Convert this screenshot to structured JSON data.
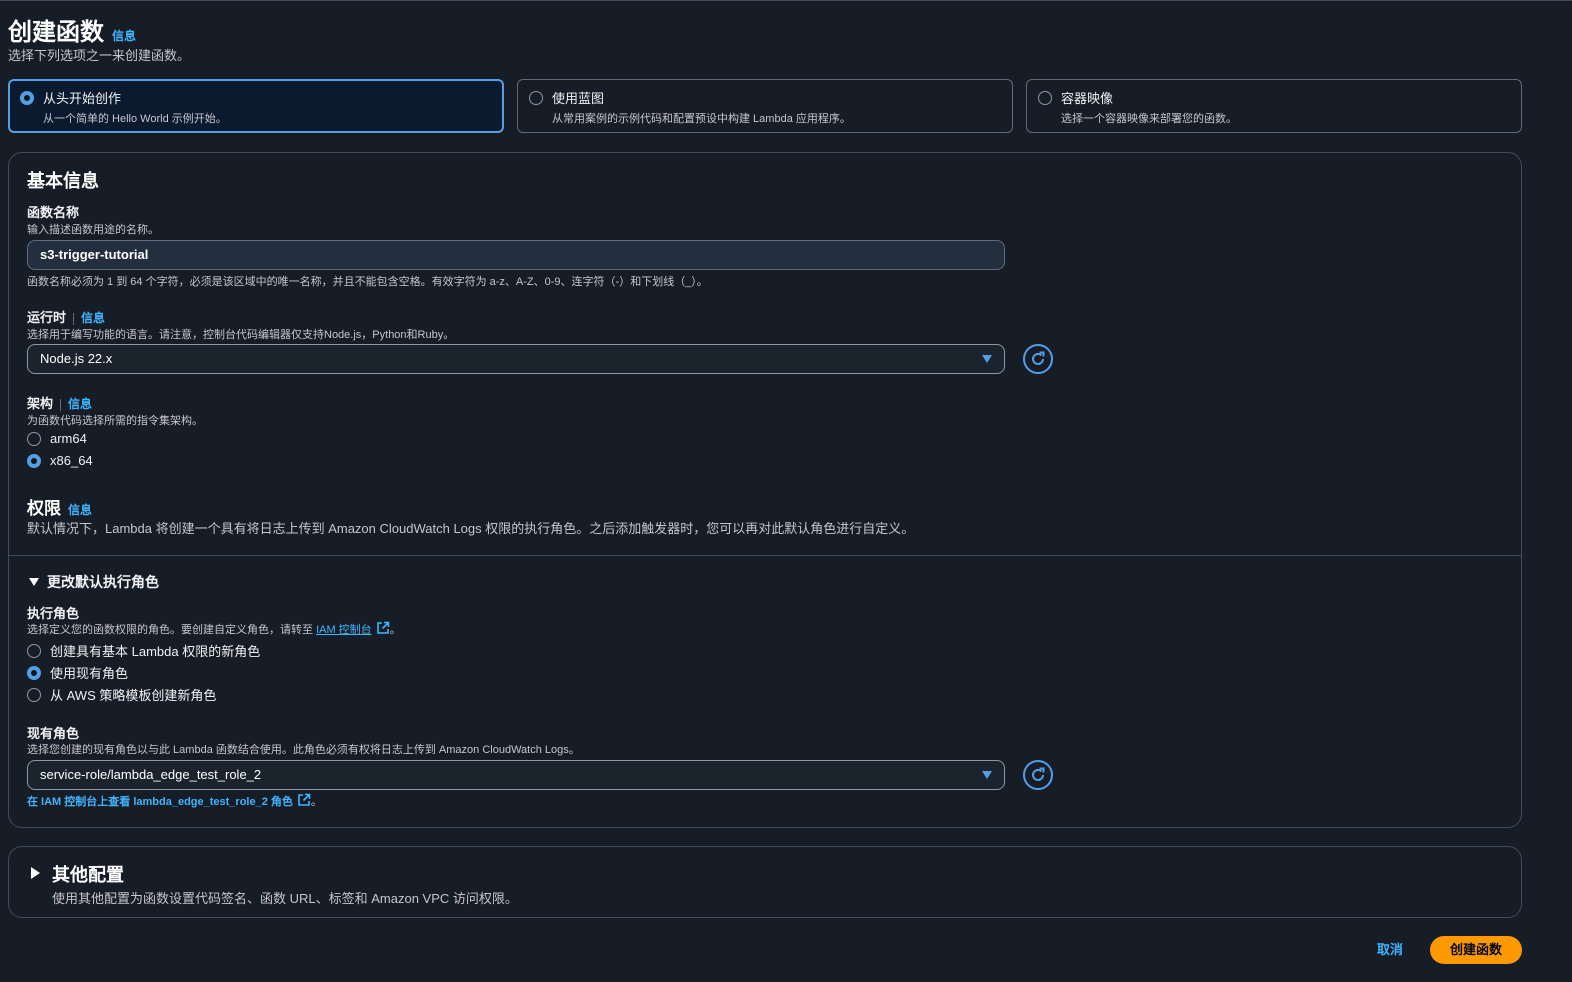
{
  "header": {
    "title": "创建函数",
    "info": "信息",
    "description": "选择下列选项之一来创建函数。"
  },
  "options": [
    {
      "title": "从头开始创作",
      "desc": "从一个简单的 Hello World 示例开始。",
      "selected": true
    },
    {
      "title": "使用蓝图",
      "desc": "从常用案例的示例代码和配置预设中构建 Lambda 应用程序。",
      "selected": false
    },
    {
      "title": "容器映像",
      "desc": "选择一个容器映像来部署您的函数。",
      "selected": false
    }
  ],
  "basic": {
    "title": "基本信息",
    "function_name": {
      "label": "函数名称",
      "desc": "输入描述函数用途的名称。",
      "value": "s3-trigger-tutorial",
      "constraint": "函数名称必须为 1 到 64 个字符，必须是该区域中的唯一名称，并且不能包含空格。有效字符为 a-z、A-Z、0-9、连字符（-）和下划线（_）。"
    },
    "runtime": {
      "label": "运行时",
      "info": "信息",
      "desc": "选择用于编写功能的语言。请注意，控制台代码编辑器仅支持Node.js，Python和Ruby。",
      "value": "Node.js 22.x"
    },
    "architecture": {
      "label": "架构",
      "info": "信息",
      "desc": "为函数代码选择所需的指令集架构。",
      "options": [
        {
          "label": "arm64",
          "selected": false
        },
        {
          "label": "x86_64",
          "selected": true
        }
      ]
    },
    "permissions": {
      "title": "权限",
      "info": "信息",
      "desc": "默认情况下，Lambda 将创建一个具有将日志上传到 Amazon CloudWatch Logs 权限的执行角色。之后添加触发器时，您可以再对此默认角色进行自定义。"
    },
    "change_role": {
      "title": "更改默认执行角色",
      "exec_role_label": "执行角色",
      "exec_role_desc_prefix": "选择定义您的函数权限的角色。要创建自定义角色，请转至 ",
      "iam_link": "IAM 控制台",
      "exec_role_desc_suffix": "。",
      "role_options": [
        {
          "label": "创建具有基本 Lambda 权限的新角色",
          "selected": false
        },
        {
          "label": "使用现有角色",
          "selected": true
        },
        {
          "label": "从 AWS 策略模板创建新角色",
          "selected": false
        }
      ],
      "existing_label": "现有角色",
      "existing_desc": "选择您创建的现有角色以与此 Lambda 函数结合使用。此角色必须有权将日志上传到 Amazon CloudWatch Logs。",
      "existing_value": "service-role/lambda_edge_test_role_2",
      "view_link": "在 IAM 控制台上查看 lambda_edge_test_role_2 角色",
      "view_link_suffix": "。"
    }
  },
  "additional": {
    "title": "其他配置",
    "desc": "使用其他配置为函数设置代码签名、函数 URL、标签和 Amazon VPC 访问权限。"
  },
  "actions": {
    "cancel": "取消",
    "create": "创建函数"
  },
  "colors": {
    "background": "#161d26",
    "accent": "#539fe5",
    "link": "#42b4ff",
    "primary_button": "#ff9900"
  }
}
